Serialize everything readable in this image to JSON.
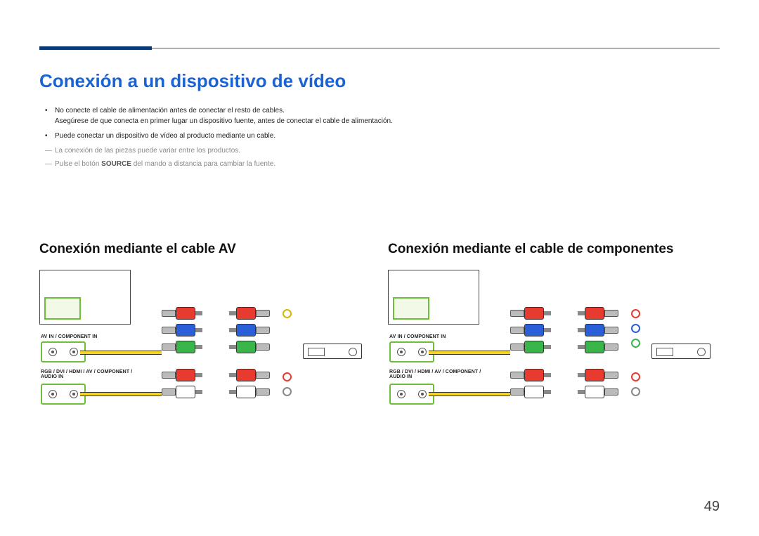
{
  "title": "Conexión a un dispositivo de vídeo",
  "bullets": [
    {
      "line1": "No conecte el cable de alimentación antes de conectar el resto de cables.",
      "line2": "Asegúrese de que conecta en primer lugar un dispositivo fuente, antes de conectar el cable de alimentación."
    },
    {
      "line1": "Puede conectar un dispositivo de vídeo al producto mediante un cable."
    }
  ],
  "footnotes": [
    {
      "pre": "La conexión de las piezas puede variar entre los productos.",
      "bold": ""
    },
    {
      "pre": "Pulse el botón ",
      "bold": "SOURCE",
      "post": " del mando a distancia para cambiar la fuente."
    }
  ],
  "bullet_dot": "•",
  "footnote_dash": "―",
  "subheading_left": "Conexión mediante el cable AV",
  "subheading_right": "Conexión mediante el cable de componentes",
  "port_labels": {
    "av_in": "AV IN / COMPONENT IN",
    "audio_in": "RGB / DVI / HDMI / AV / COMPONENT / AUDIO IN"
  },
  "page_number": "49",
  "diagrams": {
    "left": {
      "upper_plugs": [
        "red",
        "blue",
        "green"
      ],
      "lower_plugs": [
        "red",
        "white"
      ],
      "single_ring_upper": "yellow",
      "rings_lower": [
        "red",
        "white"
      ]
    },
    "right": {
      "upper_plugs": [
        "red",
        "blue",
        "green"
      ],
      "lower_plugs": [
        "red",
        "white"
      ],
      "rings_upper": [
        "red",
        "blue",
        "green"
      ],
      "rings_lower": [
        "red",
        "white"
      ]
    }
  }
}
